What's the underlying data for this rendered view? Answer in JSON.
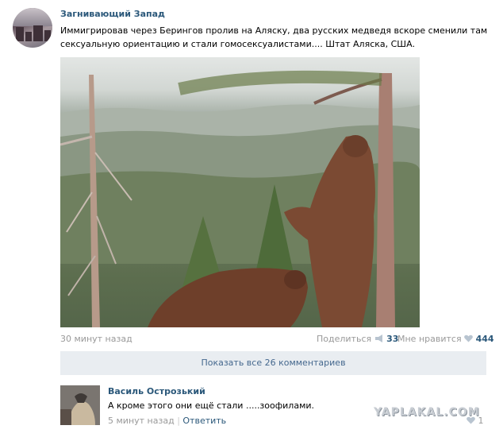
{
  "post": {
    "author": "Загнивающий Запад",
    "text": "Иммигрировав через Берингов пролив на Аляску, два русских медведя вскоре сменили там сексуальную ориентацию и стали гомосексуалистами.... Штат Аляска, США.",
    "time": "30 минут назад",
    "share_label": "Поделиться",
    "share_count": "33",
    "like_label": "Мне нравится",
    "like_count": "444"
  },
  "comments_toggle": {
    "label": "Показать все 26 комментариев"
  },
  "comment": {
    "author": "Василь Острозький",
    "text": "А кроме этого они ещё стали .....зоофилами.",
    "time": "5 минут назад",
    "reply_label": "Ответить",
    "like_count": "1"
  },
  "watermark": "YAPLAKAL.COM",
  "icons": {
    "share": "megaphone-icon",
    "like": "heart-icon"
  },
  "colors": {
    "link": "#2b587a",
    "muted": "#999999",
    "button_bg": "#e9edf1",
    "button_text": "#45688e"
  }
}
